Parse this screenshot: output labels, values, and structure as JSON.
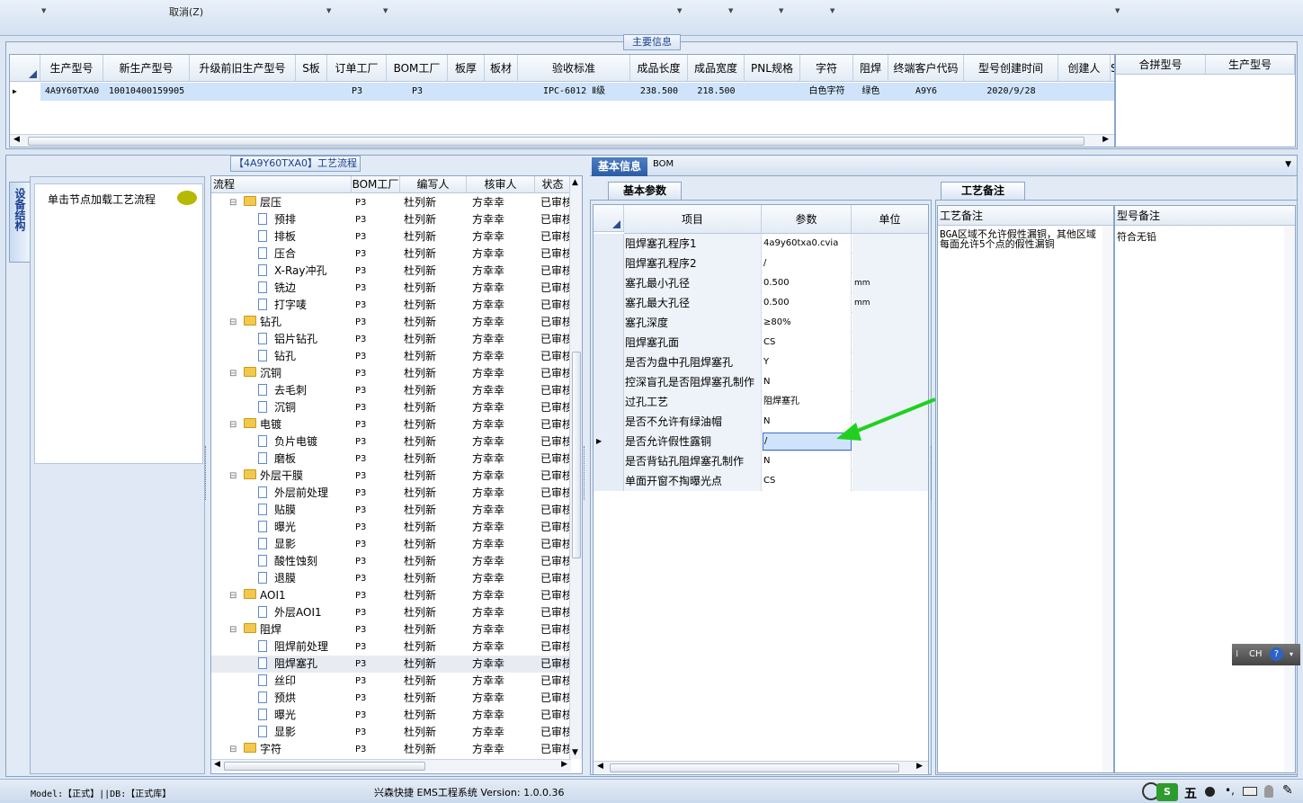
{
  "toolbar": {
    "cancel_label": "取消(Z)"
  },
  "main_info": {
    "title": "主要信息",
    "columns": [
      "生产型号",
      "新生产型号",
      "升级前旧生产型号",
      "S板",
      "订单工厂",
      "BOM工厂",
      "板厚",
      "板材",
      "验收标准",
      "成品长度",
      "成品宽度",
      "PNL规格",
      "字符",
      "阻焊",
      "终端客户代码",
      "型号创建时间",
      "创建人",
      "S("
    ],
    "row": [
      "4A9Y60TXA0",
      "10010400159905",
      "",
      "",
      "P3",
      "P3",
      "",
      "",
      "IPC-6012 Ⅱ级",
      "238.500",
      "218.500",
      "",
      "白色字符",
      "绿色",
      "A9Y6",
      "2020/9/28",
      "",
      ""
    ],
    "side_columns": [
      "合拼型号",
      "生产型号"
    ]
  },
  "left_panel": {
    "vertical_tab": "设备结构",
    "node_hint": "单击节点加载工艺流程"
  },
  "process": {
    "title": "【4A9Y60TXA0】工艺流程",
    "columns": [
      "流程",
      "BOM工厂",
      "编写人",
      "核审人",
      "状态"
    ],
    "rows": [
      {
        "name": "层压",
        "type": "folder",
        "factory": "P3",
        "writer": "杜列新",
        "reviewer": "方幸幸",
        "status": "已审核"
      },
      {
        "name": "预排",
        "type": "doc",
        "factory": "P3",
        "writer": "杜列新",
        "reviewer": "方幸幸",
        "status": "已审核"
      },
      {
        "name": "排板",
        "type": "doc",
        "factory": "P3",
        "writer": "杜列新",
        "reviewer": "方幸幸",
        "status": "已审核"
      },
      {
        "name": "压合",
        "type": "doc",
        "factory": "P3",
        "writer": "杜列新",
        "reviewer": "方幸幸",
        "status": "已审核"
      },
      {
        "name": "X-Ray冲孔",
        "type": "doc",
        "factory": "P3",
        "writer": "杜列新",
        "reviewer": "方幸幸",
        "status": "已审核"
      },
      {
        "name": "铣边",
        "type": "doc",
        "factory": "P3",
        "writer": "杜列新",
        "reviewer": "方幸幸",
        "status": "已审核"
      },
      {
        "name": "打字唛",
        "type": "doc",
        "factory": "P3",
        "writer": "杜列新",
        "reviewer": "方幸幸",
        "status": "已审核"
      },
      {
        "name": "钻孔",
        "type": "folder",
        "factory": "P3",
        "writer": "杜列新",
        "reviewer": "方幸幸",
        "status": "已审核"
      },
      {
        "name": "铝片钻孔",
        "type": "doc",
        "factory": "P3",
        "writer": "杜列新",
        "reviewer": "方幸幸",
        "status": "已审核"
      },
      {
        "name": "钻孔",
        "type": "doc",
        "factory": "P3",
        "writer": "杜列新",
        "reviewer": "方幸幸",
        "status": "已审核"
      },
      {
        "name": "沉铜",
        "type": "folder",
        "factory": "P3",
        "writer": "杜列新",
        "reviewer": "方幸幸",
        "status": "已审核"
      },
      {
        "name": "去毛刺",
        "type": "doc",
        "factory": "P3",
        "writer": "杜列新",
        "reviewer": "方幸幸",
        "status": "已审核"
      },
      {
        "name": "沉铜",
        "type": "doc",
        "factory": "P3",
        "writer": "杜列新",
        "reviewer": "方幸幸",
        "status": "已审核"
      },
      {
        "name": "电镀",
        "type": "folder",
        "factory": "P3",
        "writer": "杜列新",
        "reviewer": "方幸幸",
        "status": "已审核"
      },
      {
        "name": "负片电镀",
        "type": "doc",
        "factory": "P3",
        "writer": "杜列新",
        "reviewer": "方幸幸",
        "status": "已审核"
      },
      {
        "name": "磨板",
        "type": "doc",
        "factory": "P3",
        "writer": "杜列新",
        "reviewer": "方幸幸",
        "status": "已审核"
      },
      {
        "name": "外层干膜",
        "type": "folder",
        "factory": "P3",
        "writer": "杜列新",
        "reviewer": "方幸幸",
        "status": "已审核"
      },
      {
        "name": "外层前处理",
        "type": "doc",
        "factory": "P3",
        "writer": "杜列新",
        "reviewer": "方幸幸",
        "status": "已审核"
      },
      {
        "name": "贴膜",
        "type": "doc",
        "factory": "P3",
        "writer": "杜列新",
        "reviewer": "方幸幸",
        "status": "已审核"
      },
      {
        "name": "曝光",
        "type": "doc",
        "factory": "P3",
        "writer": "杜列新",
        "reviewer": "方幸幸",
        "status": "已审核"
      },
      {
        "name": "显影",
        "type": "doc",
        "factory": "P3",
        "writer": "杜列新",
        "reviewer": "方幸幸",
        "status": "已审核"
      },
      {
        "name": "酸性蚀刻",
        "type": "doc",
        "factory": "P3",
        "writer": "杜列新",
        "reviewer": "方幸幸",
        "status": "已审核"
      },
      {
        "name": "退膜",
        "type": "doc",
        "factory": "P3",
        "writer": "杜列新",
        "reviewer": "方幸幸",
        "status": "已审核"
      },
      {
        "name": "AOI1",
        "type": "folder",
        "factory": "P3",
        "writer": "杜列新",
        "reviewer": "方幸幸",
        "status": "已审核"
      },
      {
        "name": "外层AOI1",
        "type": "doc",
        "factory": "P3",
        "writer": "杜列新",
        "reviewer": "方幸幸",
        "status": "已审核"
      },
      {
        "name": "阻焊",
        "type": "folder",
        "factory": "P3",
        "writer": "杜列新",
        "reviewer": "方幸幸",
        "status": "已审核"
      },
      {
        "name": "阻焊前处理",
        "type": "doc",
        "factory": "P3",
        "writer": "杜列新",
        "reviewer": "方幸幸",
        "status": "已审核"
      },
      {
        "name": "阻焊塞孔",
        "type": "doc",
        "factory": "P3",
        "writer": "杜列新",
        "reviewer": "方幸幸",
        "status": "已审核",
        "selected": true
      },
      {
        "name": "丝印",
        "type": "doc",
        "factory": "P3",
        "writer": "杜列新",
        "reviewer": "方幸幸",
        "status": "已审核"
      },
      {
        "name": "预烘",
        "type": "doc",
        "factory": "P3",
        "writer": "杜列新",
        "reviewer": "方幸幸",
        "status": "已审核"
      },
      {
        "name": "曝光",
        "type": "doc",
        "factory": "P3",
        "writer": "杜列新",
        "reviewer": "方幸幸",
        "status": "已审核"
      },
      {
        "name": "显影",
        "type": "doc",
        "factory": "P3",
        "writer": "杜列新",
        "reviewer": "方幸幸",
        "status": "已审核"
      },
      {
        "name": "字符",
        "type": "folder",
        "factory": "P3",
        "writer": "杜列新",
        "reviewer": "方幸幸",
        "status": "已审核"
      }
    ]
  },
  "info_tabs": {
    "basic": "基本信息",
    "bom": "BOM"
  },
  "params": {
    "tab": "基本参数",
    "columns": [
      "项目",
      "参数",
      "单位"
    ],
    "rows": [
      {
        "item": "阻焊塞孔程序1",
        "value": "4a9y60txa0.cvia",
        "unit": ""
      },
      {
        "item": "阻焊塞孔程序2",
        "value": "/",
        "unit": ""
      },
      {
        "item": "塞孔最小孔径",
        "value": "0.500",
        "unit": "mm"
      },
      {
        "item": "塞孔最大孔径",
        "value": "0.500",
        "unit": "mm"
      },
      {
        "item": "塞孔深度",
        "value": "≥80%",
        "unit": ""
      },
      {
        "item": "阻焊塞孔面",
        "value": "CS",
        "unit": ""
      },
      {
        "item": "是否为盘中孔阻焊塞孔",
        "value": "Y",
        "unit": ""
      },
      {
        "item": "控深盲孔是否阻焊塞孔制作",
        "value": "N",
        "unit": ""
      },
      {
        "item": "过孔工艺",
        "value": "阻焊塞孔",
        "unit": ""
      },
      {
        "item": "是否不允许有绿油帽",
        "value": "N",
        "unit": ""
      },
      {
        "item": "是否允许假性露铜",
        "value": "/",
        "unit": "",
        "selected": true
      },
      {
        "item": "是否背钻孔阻焊塞孔制作",
        "value": "N",
        "unit": ""
      },
      {
        "item": "单面开窗不掏曝光点",
        "value": "CS",
        "unit": ""
      }
    ]
  },
  "notes": {
    "tab": "工艺备注",
    "col1": "工艺备注",
    "col2": "型号备注",
    "process_note": "BGA区域不允许假性漏铜，其他区域每面允许5个点的假性漏铜",
    "model_note": "符合无铅"
  },
  "ime": {
    "label": "CH"
  },
  "status": {
    "model": "Model:【正式】||DB:【正式库】",
    "app": "兴森快捷 EMS工程系统 Version: 1.0.0.36"
  },
  "tray": {
    "char": "五"
  },
  "colors": {
    "selection": "#cfe4fb",
    "header": "#e3ebf5",
    "arrow": "#1fd11f"
  }
}
